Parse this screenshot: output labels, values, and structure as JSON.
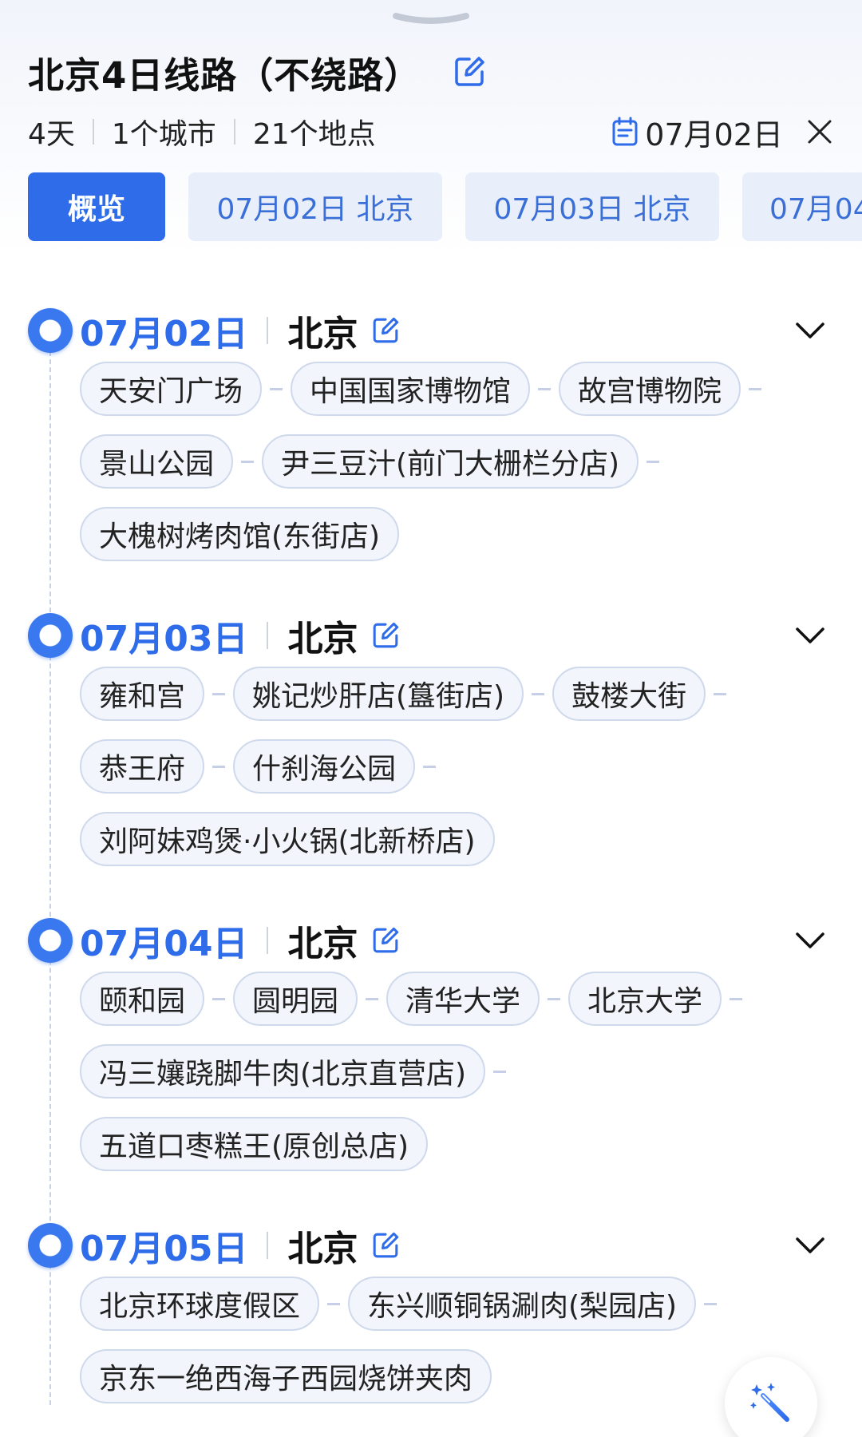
{
  "header": {
    "title": "北京4日线路（不绕路）",
    "days": "4天",
    "cities": "1个城市",
    "places": "21个地点",
    "date": "07月02日"
  },
  "tabs": [
    "概览",
    "07月02日  北京",
    "07月03日  北京",
    "07月04"
  ],
  "days": [
    {
      "date": "07月02日",
      "city": "北京",
      "rows": [
        [
          "天安门广场",
          "中国国家博物馆",
          "故宫博物院"
        ],
        [
          "景山公园",
          "尹三豆汁(前门大栅栏分店)"
        ],
        [
          "大槐树烤肉馆(东街店)"
        ]
      ]
    },
    {
      "date": "07月03日",
      "city": "北京",
      "rows": [
        [
          "雍和宫",
          "姚记炒肝店(簋街店)",
          "鼓楼大街"
        ],
        [
          "恭王府",
          "什刹海公园"
        ],
        [
          "刘阿妹鸡煲·小火锅(北新桥店)"
        ]
      ]
    },
    {
      "date": "07月04日",
      "city": "北京",
      "rows": [
        [
          "颐和园",
          "圆明园",
          "清华大学",
          "北京大学"
        ],
        [
          "冯三孃跷脚牛肉(北京直营店)"
        ],
        [
          "五道口枣糕王(原创总店)"
        ]
      ]
    },
    {
      "date": "07月05日",
      "city": "北京",
      "rows": [
        [
          "北京环球度假区",
          "东兴顺铜锅涮肉(梨园店)"
        ],
        [
          "京东一绝西海子西园烧饼夹肉"
        ]
      ]
    }
  ],
  "icons": {
    "handle": "drag-handle-icon",
    "title_edit": "edit-icon",
    "calendar": "calendar-icon",
    "close": "close-icon",
    "chevron": "chevron-down-icon",
    "fab": "magic-wand-icon"
  },
  "colors": {
    "accent": "#2f6cea",
    "chip_bg": "#f2f5fb",
    "tab_bg": "#e8effb"
  }
}
